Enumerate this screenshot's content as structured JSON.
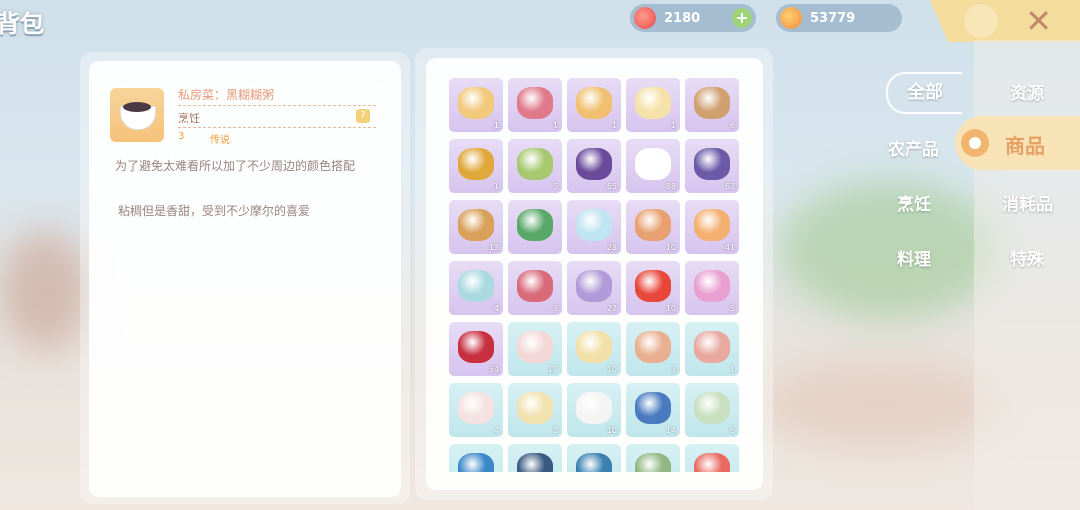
{
  "header": {
    "title": "背包",
    "currency_1": {
      "icon": "peach-coin-icon",
      "value": "2180"
    },
    "currency_2": {
      "icon": "sausage-coin-icon",
      "value": "53779"
    },
    "add_symbol": "+",
    "close_symbol": "✕"
  },
  "detail": {
    "name": "私房菜：黑糊糊粥",
    "category": "烹饪",
    "help_symbol": "?",
    "level": "3",
    "rarity": "传说",
    "description": "为了避免太难看所以加了不少周边的颜色搭配",
    "flavor": "粘稠但是香甜，受到不少摩尔的喜爱"
  },
  "filters": {
    "all": "全部",
    "left": [
      "农产品",
      "烹饪",
      "料理"
    ],
    "right": [
      "资源",
      "商品",
      "消耗品",
      "特殊"
    ],
    "active": "商品"
  },
  "items": [
    {
      "color": "#f2c87a",
      "bg": "purple",
      "qty": "1"
    },
    {
      "color": "#e07a8a",
      "bg": "purple",
      "qty": "1"
    },
    {
      "color": "#f0c070",
      "bg": "purple",
      "qty": "1"
    },
    {
      "color": "#f4e2a8",
      "bg": "purple",
      "qty": "1"
    },
    {
      "color": "#d0a070",
      "bg": "purple",
      "qty": "6"
    },
    {
      "color": "#e0a83a",
      "bg": "purple",
      "qty": "1"
    },
    {
      "color": "#a8c870",
      "bg": "purple",
      "qty": "5"
    },
    {
      "color": "#6a4a9a",
      "bg": "purple",
      "qty": "65"
    },
    {
      "color": "#ffffff",
      "bg": "purple",
      "qty": "88"
    },
    {
      "color": "#6a5aa8",
      "bg": "purple",
      "qty": "63"
    },
    {
      "color": "#d8a058",
      "bg": "purple",
      "qty": "13"
    },
    {
      "color": "#5aa868",
      "bg": "purple",
      "qty": ""
    },
    {
      "color": "#bfe4f2",
      "bg": "purple",
      "qty": "28"
    },
    {
      "color": "#e8a070",
      "bg": "purple",
      "qty": "10"
    },
    {
      "color": "#f4b070",
      "bg": "purple",
      "qty": "41"
    },
    {
      "color": "#a8dae0",
      "bg": "purple",
      "qty": "4"
    },
    {
      "color": "#d86a7a",
      "bg": "purple",
      "qty": "3"
    },
    {
      "color": "#b09ad8",
      "bg": "purple",
      "qty": "27"
    },
    {
      "color": "#e8483a",
      "bg": "purple",
      "qty": "10"
    },
    {
      "color": "#e8a0d0",
      "bg": "purple",
      "qty": "5"
    },
    {
      "color": "#c83040",
      "bg": "purple",
      "qty": "54"
    },
    {
      "color": "#f4d8d8",
      "bg": "blue",
      "qty": "17"
    },
    {
      "color": "#f2e0a8",
      "bg": "blue",
      "qty": "10"
    },
    {
      "color": "#e8b090",
      "bg": "blue",
      "qty": "3"
    },
    {
      "color": "#e8a8a0",
      "bg": "blue",
      "qty": "1"
    },
    {
      "color": "#f4e2e2",
      "bg": "blue",
      "qty": "4"
    },
    {
      "color": "#f2e2b0",
      "bg": "blue",
      "qty": "8"
    },
    {
      "color": "#f4f4f4",
      "bg": "blue",
      "qty": "10"
    },
    {
      "color": "#4a7ac0",
      "bg": "blue",
      "qty": "14"
    },
    {
      "color": "#c8e0c0",
      "bg": "blue",
      "qty": "6"
    },
    {
      "color": "#3a88c8",
      "bg": "blue",
      "qty": ""
    },
    {
      "color": "#3a5a80",
      "bg": "blue",
      "qty": ""
    },
    {
      "color": "#3a80b0",
      "bg": "blue",
      "qty": ""
    },
    {
      "color": "#90b880",
      "bg": "blue",
      "qty": ""
    },
    {
      "color": "#e86a60",
      "bg": "blue",
      "qty": ""
    }
  ]
}
